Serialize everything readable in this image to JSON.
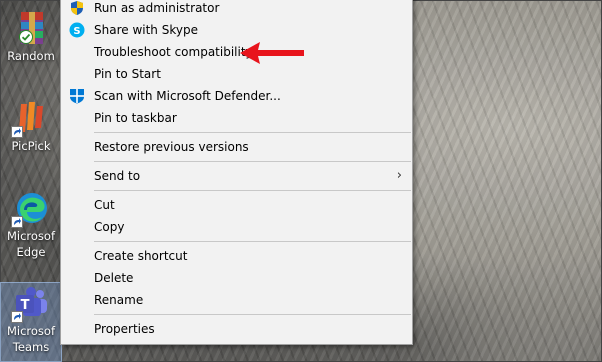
{
  "desktop": {
    "icons": [
      {
        "label": "Random"
      },
      {
        "label": "PicPick"
      },
      {
        "label": "Microsoft Edge",
        "line1": "Microsof",
        "line2": "Edge"
      },
      {
        "label": "Microsoft Teams",
        "line1": "Microsof",
        "line2": "Teams"
      }
    ]
  },
  "menu": {
    "run_as_admin": "Run as administrator",
    "share_skype": "Share with Skype",
    "troubleshoot": "Troubleshoot compatibility",
    "pin_start": "Pin to Start",
    "scan_defender": "Scan with Microsoft Defender...",
    "pin_taskbar": "Pin to taskbar",
    "restore_versions": "Restore previous versions",
    "send_to": "Send to",
    "cut": "Cut",
    "copy": "Copy",
    "create_shortcut": "Create shortcut",
    "delete": "Delete",
    "rename": "Rename",
    "properties": "Properties",
    "submenu_glyph": "›"
  },
  "colors": {
    "annotation_arrow": "#e8141c",
    "skype_blue": "#00aff0",
    "defender_blue": "#0078d4"
  }
}
